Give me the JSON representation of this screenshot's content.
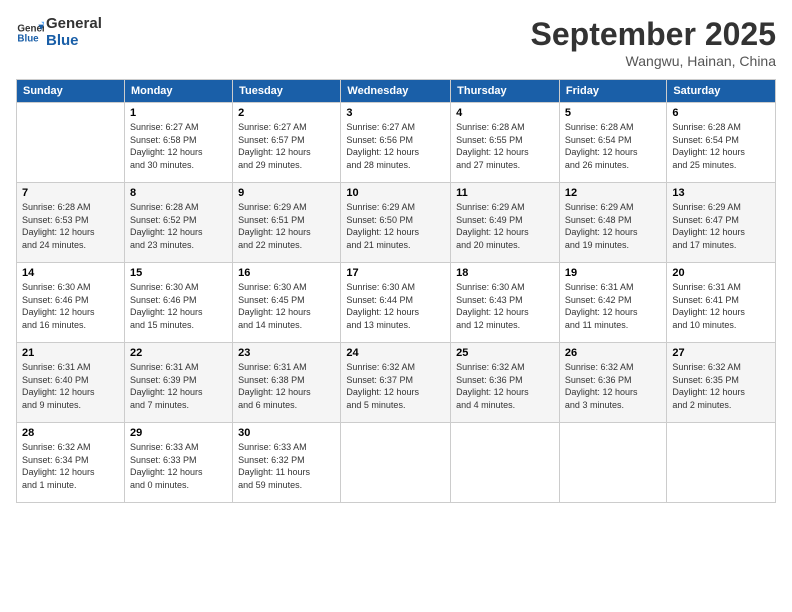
{
  "header": {
    "logo_line1": "General",
    "logo_line2": "Blue",
    "month": "September 2025",
    "location": "Wangwu, Hainan, China"
  },
  "days_of_week": [
    "Sunday",
    "Monday",
    "Tuesday",
    "Wednesday",
    "Thursday",
    "Friday",
    "Saturday"
  ],
  "weeks": [
    [
      {
        "num": "",
        "info": ""
      },
      {
        "num": "1",
        "info": "Sunrise: 6:27 AM\nSunset: 6:58 PM\nDaylight: 12 hours\nand 30 minutes."
      },
      {
        "num": "2",
        "info": "Sunrise: 6:27 AM\nSunset: 6:57 PM\nDaylight: 12 hours\nand 29 minutes."
      },
      {
        "num": "3",
        "info": "Sunrise: 6:27 AM\nSunset: 6:56 PM\nDaylight: 12 hours\nand 28 minutes."
      },
      {
        "num": "4",
        "info": "Sunrise: 6:28 AM\nSunset: 6:55 PM\nDaylight: 12 hours\nand 27 minutes."
      },
      {
        "num": "5",
        "info": "Sunrise: 6:28 AM\nSunset: 6:54 PM\nDaylight: 12 hours\nand 26 minutes."
      },
      {
        "num": "6",
        "info": "Sunrise: 6:28 AM\nSunset: 6:54 PM\nDaylight: 12 hours\nand 25 minutes."
      }
    ],
    [
      {
        "num": "7",
        "info": "Sunrise: 6:28 AM\nSunset: 6:53 PM\nDaylight: 12 hours\nand 24 minutes."
      },
      {
        "num": "8",
        "info": "Sunrise: 6:28 AM\nSunset: 6:52 PM\nDaylight: 12 hours\nand 23 minutes."
      },
      {
        "num": "9",
        "info": "Sunrise: 6:29 AM\nSunset: 6:51 PM\nDaylight: 12 hours\nand 22 minutes."
      },
      {
        "num": "10",
        "info": "Sunrise: 6:29 AM\nSunset: 6:50 PM\nDaylight: 12 hours\nand 21 minutes."
      },
      {
        "num": "11",
        "info": "Sunrise: 6:29 AM\nSunset: 6:49 PM\nDaylight: 12 hours\nand 20 minutes."
      },
      {
        "num": "12",
        "info": "Sunrise: 6:29 AM\nSunset: 6:48 PM\nDaylight: 12 hours\nand 19 minutes."
      },
      {
        "num": "13",
        "info": "Sunrise: 6:29 AM\nSunset: 6:47 PM\nDaylight: 12 hours\nand 17 minutes."
      }
    ],
    [
      {
        "num": "14",
        "info": "Sunrise: 6:30 AM\nSunset: 6:46 PM\nDaylight: 12 hours\nand 16 minutes."
      },
      {
        "num": "15",
        "info": "Sunrise: 6:30 AM\nSunset: 6:46 PM\nDaylight: 12 hours\nand 15 minutes."
      },
      {
        "num": "16",
        "info": "Sunrise: 6:30 AM\nSunset: 6:45 PM\nDaylight: 12 hours\nand 14 minutes."
      },
      {
        "num": "17",
        "info": "Sunrise: 6:30 AM\nSunset: 6:44 PM\nDaylight: 12 hours\nand 13 minutes."
      },
      {
        "num": "18",
        "info": "Sunrise: 6:30 AM\nSunset: 6:43 PM\nDaylight: 12 hours\nand 12 minutes."
      },
      {
        "num": "19",
        "info": "Sunrise: 6:31 AM\nSunset: 6:42 PM\nDaylight: 12 hours\nand 11 minutes."
      },
      {
        "num": "20",
        "info": "Sunrise: 6:31 AM\nSunset: 6:41 PM\nDaylight: 12 hours\nand 10 minutes."
      }
    ],
    [
      {
        "num": "21",
        "info": "Sunrise: 6:31 AM\nSunset: 6:40 PM\nDaylight: 12 hours\nand 9 minutes."
      },
      {
        "num": "22",
        "info": "Sunrise: 6:31 AM\nSunset: 6:39 PM\nDaylight: 12 hours\nand 7 minutes."
      },
      {
        "num": "23",
        "info": "Sunrise: 6:31 AM\nSunset: 6:38 PM\nDaylight: 12 hours\nand 6 minutes."
      },
      {
        "num": "24",
        "info": "Sunrise: 6:32 AM\nSunset: 6:37 PM\nDaylight: 12 hours\nand 5 minutes."
      },
      {
        "num": "25",
        "info": "Sunrise: 6:32 AM\nSunset: 6:36 PM\nDaylight: 12 hours\nand 4 minutes."
      },
      {
        "num": "26",
        "info": "Sunrise: 6:32 AM\nSunset: 6:36 PM\nDaylight: 12 hours\nand 3 minutes."
      },
      {
        "num": "27",
        "info": "Sunrise: 6:32 AM\nSunset: 6:35 PM\nDaylight: 12 hours\nand 2 minutes."
      }
    ],
    [
      {
        "num": "28",
        "info": "Sunrise: 6:32 AM\nSunset: 6:34 PM\nDaylight: 12 hours\nand 1 minute."
      },
      {
        "num": "29",
        "info": "Sunrise: 6:33 AM\nSunset: 6:33 PM\nDaylight: 12 hours\nand 0 minutes."
      },
      {
        "num": "30",
        "info": "Sunrise: 6:33 AM\nSunset: 6:32 PM\nDaylight: 11 hours\nand 59 minutes."
      },
      {
        "num": "",
        "info": ""
      },
      {
        "num": "",
        "info": ""
      },
      {
        "num": "",
        "info": ""
      },
      {
        "num": "",
        "info": ""
      }
    ]
  ]
}
